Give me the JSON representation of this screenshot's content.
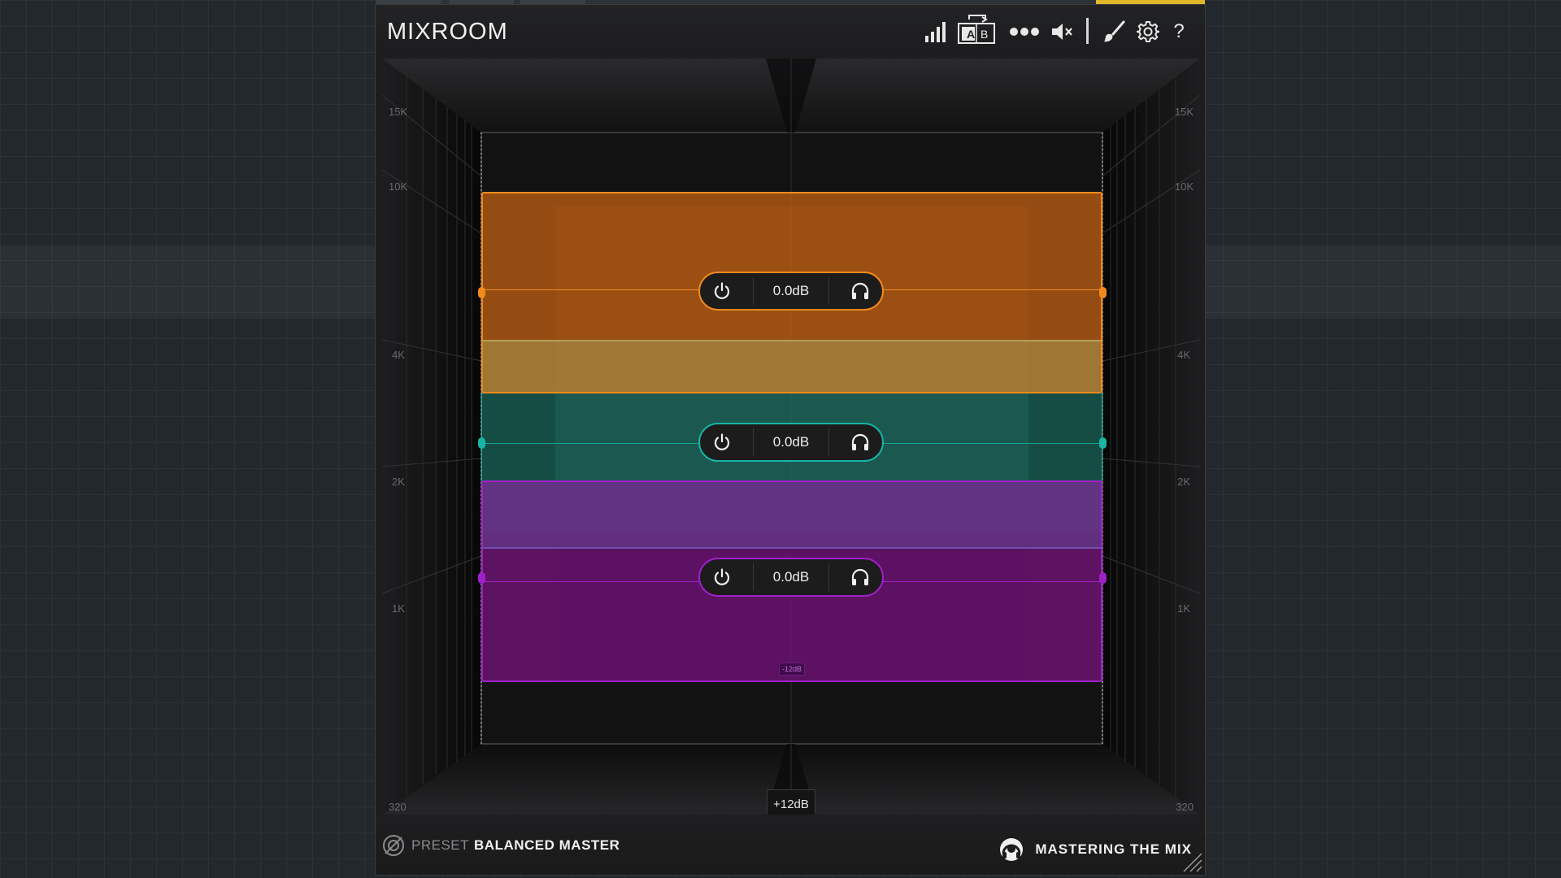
{
  "app": {
    "title": "MIXROOM",
    "colors": {
      "orange": "#f08a1c",
      "teal": "#17b4a4",
      "purple": "#a020c8",
      "host_accent": "#e2b72a"
    }
  },
  "toolbar": {
    "icons": [
      "meters-icon",
      "ab-compare-icon",
      "more-icon",
      "mute-icon",
      "brush-icon",
      "settings-icon",
      "help-icon"
    ],
    "ab_a": "A",
    "ab_b": "B",
    "help": "?"
  },
  "axis": {
    "left": [
      "15K",
      "10K",
      "4K",
      "2K",
      "1K",
      "320"
    ],
    "right": [
      "15K",
      "10K",
      "4K",
      "2K",
      "1K",
      "320"
    ]
  },
  "bands": [
    {
      "name": "high",
      "gain": "0.0dB",
      "color": "#f08a1c"
    },
    {
      "name": "mid",
      "gain": "0.0dB",
      "color": "#17b4a4"
    },
    {
      "name": "low",
      "gain": "0.0dB",
      "color": "#a020c8"
    }
  ],
  "scale": {
    "bottom_marker": "-12dB",
    "gain_readout": "+12dB"
  },
  "footer": {
    "preset_prefix": "PRESET",
    "preset_name": "BALANCED MASTER",
    "brand": "MASTERING THE MIX"
  }
}
